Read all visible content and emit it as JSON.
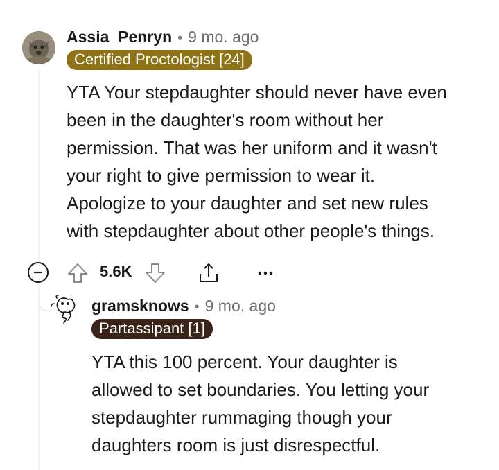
{
  "comment": {
    "username": "Assia_Penryn",
    "separator": "•",
    "timestamp": "9 mo. ago",
    "flair": {
      "text": "Certified Proctologist [24]",
      "color": "#8e7417"
    },
    "body_lines": [
      "YTA Your stepdaughter should never have even",
      "been in the daughter's room without her",
      "permission. That was her uniform and it wasn't",
      "your right to give permission to wear it.",
      "Apologize to your daughter and set new rules",
      "with stepdaughter about other people's things."
    ],
    "score": "5.6K",
    "actions": {
      "collapse": "collapse-icon",
      "upvote": "upvote-icon",
      "downvote": "downvote-icon",
      "share": "share-icon",
      "more": "more-options-icon"
    }
  },
  "reply": {
    "username": "gramsknows",
    "separator": "•",
    "timestamp": "9 mo. ago",
    "flair": {
      "text": "Partassipant [1]",
      "color": "#3a2419"
    },
    "body_lines": [
      "YTA this 100 percent. Your daughter is",
      "allowed to set boundaries. You letting your",
      "stepdaughter rummaging though your",
      "daughters room is just disrespectful."
    ]
  }
}
